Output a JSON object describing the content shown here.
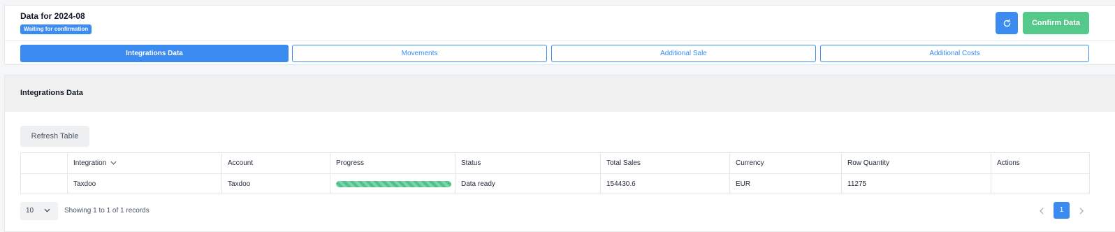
{
  "header": {
    "title": "Data for 2024-08",
    "status_badge": "Waiting for confirmation",
    "reload_icon": "refresh-icon",
    "confirm_label": "Confirm Data"
  },
  "tabs": [
    {
      "label": "Integrations Data",
      "active": true
    },
    {
      "label": "Movements",
      "active": false
    },
    {
      "label": "Additional Sale",
      "active": false
    },
    {
      "label": "Additional Costs",
      "active": false
    }
  ],
  "section": {
    "title": "Integrations Data",
    "refresh_label": "Refresh Table"
  },
  "table": {
    "columns": [
      "",
      "Integration",
      "Account",
      "Progress",
      "Status",
      "Total Sales",
      "Currency",
      "Row Quantity",
      "Actions"
    ],
    "rows": [
      {
        "integration": "Taxdoo",
        "account": "Taxdoo",
        "progress": 1.0,
        "status": "Data ready",
        "total_sales": "154430.6",
        "currency": "EUR",
        "row_quantity": "11275",
        "actions": ""
      }
    ]
  },
  "pagination": {
    "page_size": "10",
    "records_info": "Showing 1 to 1 of 1 records",
    "current_page": "1"
  },
  "colors": {
    "accent": "#3b8bf0",
    "confirm": "#54c98a",
    "progress": "#4ec28a"
  }
}
